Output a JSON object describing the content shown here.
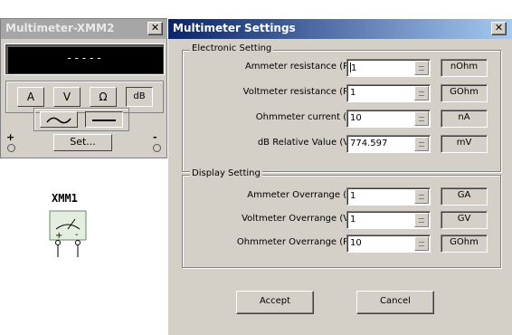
{
  "instrument": {
    "title": "Multimeter-XMM2",
    "reading": "-----",
    "modes": {
      "amps": "A",
      "volts": "V",
      "ohms": "Ω",
      "decibel": "dB"
    },
    "set_label": "Set...",
    "terminal_plus": "+",
    "terminal_minus": "-",
    "selected_mode": "dB",
    "selected_signal": "DC"
  },
  "schematic": {
    "label": "XMM1",
    "plus": "+",
    "minus": "-"
  },
  "dialog": {
    "title": "Multimeter Settings",
    "close_label": "X",
    "electronic": {
      "legend": "Electronic Setting",
      "rows": [
        {
          "label": "Ammeter resistance (R)",
          "value": "1",
          "unit": "nOhm"
        },
        {
          "label": "Voltmeter resistance (R)",
          "value": "1",
          "unit": "GOhm"
        },
        {
          "label": "Ohmmeter current (I)",
          "value": "10",
          "unit": "nA"
        },
        {
          "label": "dB Relative Value (V)",
          "value": "774.597",
          "unit": "mV"
        }
      ]
    },
    "display": {
      "legend": "Display Setting",
      "rows": [
        {
          "label": "Ammeter Overrange (I)",
          "value": "1",
          "unit": "GA"
        },
        {
          "label": "Voltmeter Overrange (V)",
          "value": "1",
          "unit": "GV"
        },
        {
          "label": "Ohmmeter Overrange (R)",
          "value": "10",
          "unit": "GOhm"
        }
      ]
    },
    "accept_label": "Accept",
    "cancel_label": "Cancel"
  }
}
